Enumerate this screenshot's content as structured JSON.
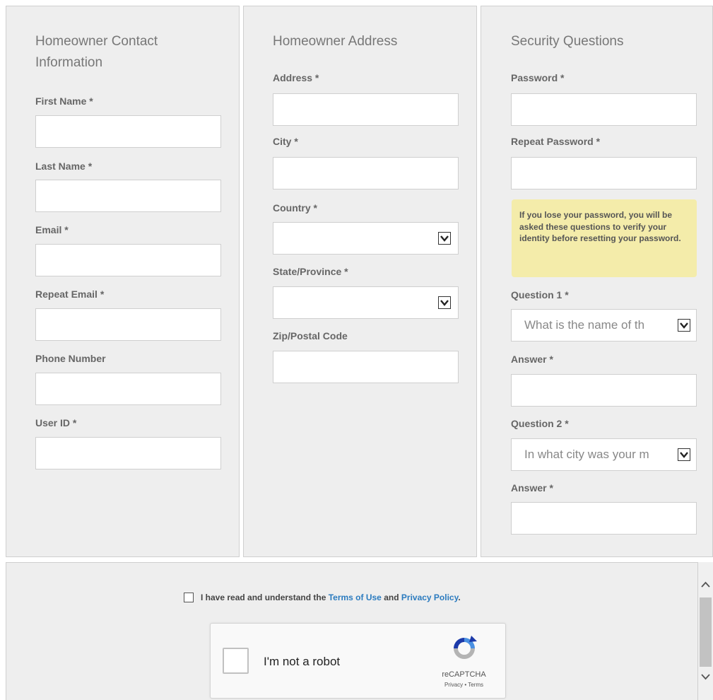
{
  "contact": {
    "heading": "Homeowner Contact Information",
    "fields": {
      "first_name": {
        "label": "First Name *",
        "value": ""
      },
      "last_name": {
        "label": "Last Name *",
        "value": ""
      },
      "email": {
        "label": "Email *",
        "value": ""
      },
      "repeat_email": {
        "label": "Repeat Email *",
        "value": ""
      },
      "phone": {
        "label": "Phone Number",
        "value": ""
      },
      "user_id": {
        "label": "User ID *",
        "value": ""
      }
    }
  },
  "address": {
    "heading": "Homeowner Address",
    "fields": {
      "address": {
        "label": "Address *",
        "value": ""
      },
      "city": {
        "label": "City *",
        "value": ""
      },
      "country": {
        "label": "Country *",
        "value": ""
      },
      "state": {
        "label": "State/Province *",
        "value": ""
      },
      "zip": {
        "label": "Zip/Postal Code",
        "value": ""
      }
    }
  },
  "security": {
    "heading": "Security Questions",
    "fields": {
      "password": {
        "label": "Password *",
        "value": ""
      },
      "repeat_password": {
        "label": "Repeat Password *",
        "value": ""
      },
      "question1": {
        "label": "Question 1 *",
        "value": "What is the name of th"
      },
      "answer1": {
        "label": "Answer *",
        "value": ""
      },
      "question2": {
        "label": "Question 2 *",
        "value": "In what city was your m"
      },
      "answer2": {
        "label": "Answer *",
        "value": ""
      }
    },
    "note": "If you lose your password, you will be asked these questions to verify your identity before resetting your password."
  },
  "agreement": {
    "prefix": "I have read and understand the",
    "terms_link": "Terms of Use",
    "and": "and",
    "privacy_link": "Privacy Policy",
    "suffix": ".",
    "checked": false
  },
  "captcha": {
    "label": "I'm not a robot",
    "brand": "reCAPTCHA",
    "links": "Privacy • Terms",
    "checked": false
  },
  "icons": {
    "dropdown": "chevron-down-icon",
    "captcha_logo": "recaptcha-logo-icon",
    "scroll_up": "chevron-up-icon",
    "scroll_down": "chevron-down-icon"
  },
  "colors": {
    "panel_bg": "#eeeeee",
    "note_bg": "#f4ecaa",
    "link": "#2b7bbf"
  }
}
